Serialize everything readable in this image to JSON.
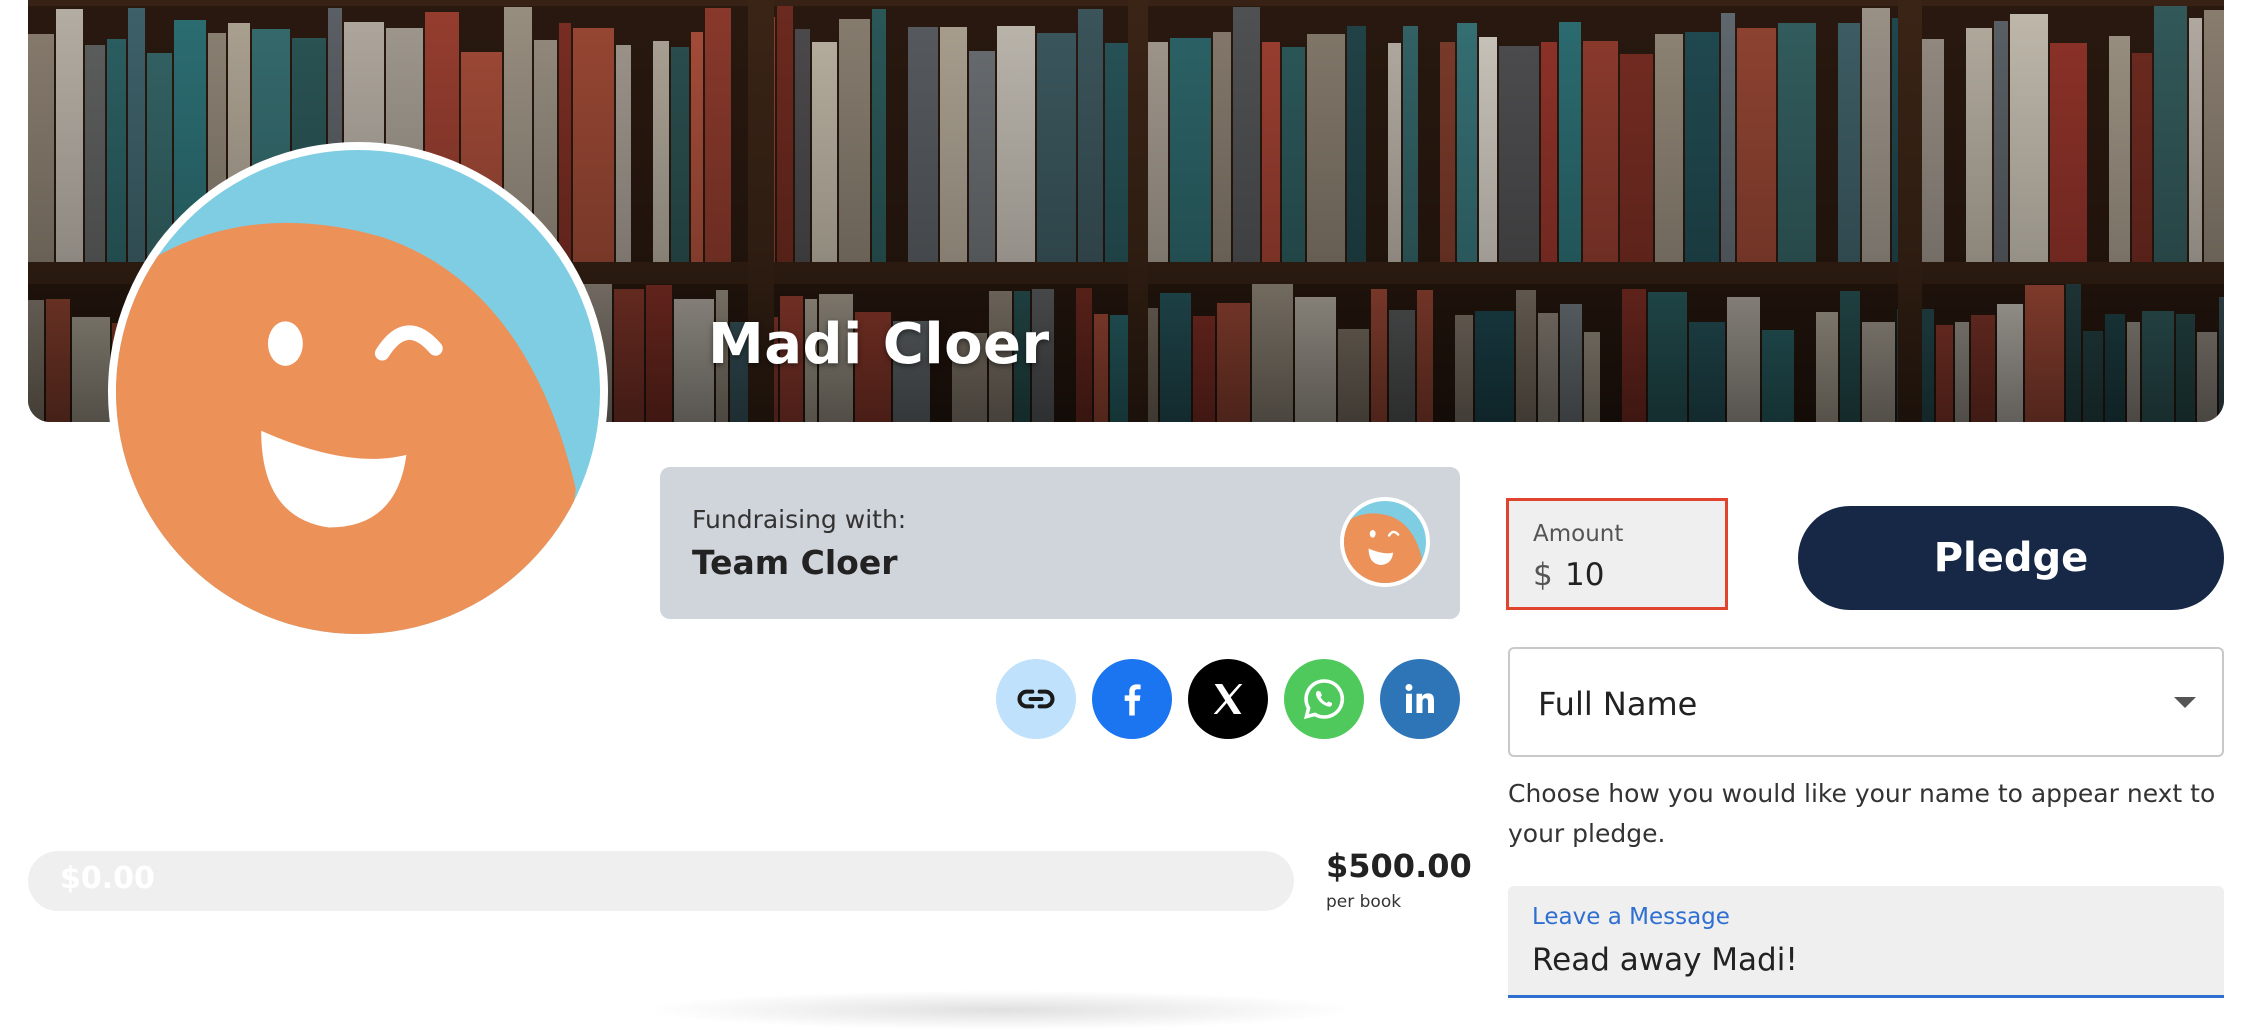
{
  "profile": {
    "name": "Madi Cloer"
  },
  "fundraising": {
    "label": "Fundraising with:",
    "team": "Team Cloer"
  },
  "share": [
    {
      "name": "link-icon"
    },
    {
      "name": "facebook-icon"
    },
    {
      "name": "x-icon"
    },
    {
      "name": "whatsapp-icon"
    },
    {
      "name": "linkedin-icon"
    }
  ],
  "progress": {
    "raised": "$0.00",
    "fraction": 0,
    "goal": "$500.00",
    "goal_unit": "per book"
  },
  "pledge_form": {
    "amount_label": "Amount",
    "currency": "$",
    "amount_value": "10",
    "pledge_button": "Pledge",
    "name_display_value": "Full Name",
    "name_help": "Choose how you would like your name to appear next to your pledge.",
    "message_label": "Leave a Message",
    "message_value": "Read away Madi!"
  },
  "colors": {
    "avatar_orange": "#ec9158",
    "avatar_blue": "#7fcde3",
    "pledge_button": "#172746",
    "amount_focus_border": "#e0442e",
    "message_accent": "#2e6fd1"
  }
}
